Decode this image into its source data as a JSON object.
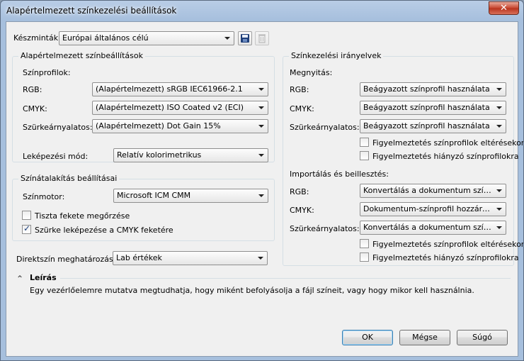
{
  "window": {
    "title": "Alapértelmezett színkezelési beállítások",
    "close_glyph": "✕"
  },
  "presets": {
    "label": "Készminták:",
    "value": "Európai általános célú"
  },
  "defaults_group": {
    "title": "Alapértelmezett színbeállítások",
    "profiles_heading": "Színprofilok:",
    "rgb_label": "RGB:",
    "rgb_value": "(Alapértelmezett) sRGB IEC61966-2.1",
    "cmyk_label": "CMYK:",
    "cmyk_value": "(Alapértelmezett) ISO Coated v2 (ECI)",
    "gray_label": "Szürkeárnyalatos:",
    "gray_value": "(Alapértelmezett) Dot Gain 15%",
    "mapping_label": "Leképezési mód:",
    "mapping_value": "Relatív kolorimetrikus"
  },
  "conversion_group": {
    "title": "Színátalakítás beállításai",
    "engine_label": "Színmotor:",
    "engine_value": "Microsoft ICM CMM",
    "preserve_black": "Tiszta fekete megőrzése",
    "preserve_black_checked": false,
    "gray_to_black": "Szürke leképezése a CMYK feketére",
    "gray_to_black_checked": true
  },
  "spot": {
    "label": "Direktszín meghatározása:",
    "value": "Lab értékek"
  },
  "policy_group": {
    "title": "Színkezelési irányelvek",
    "open_heading": "Megnyitás:",
    "open_rgb_label": "RGB:",
    "open_rgb_value": "Beágyazott színprofil használata",
    "open_cmyk_label": "CMYK:",
    "open_cmyk_value": "Beágyazott színprofil használata",
    "open_gray_label": "Szürkeárnyalatos:",
    "open_gray_value": "Beágyazott színprofil használata",
    "open_warn_mismatch": "Figyelmeztetés színprofilok eltérésekor",
    "open_warn_missing": "Figyelmeztetés hiányzó színprofilokra",
    "import_heading": "Importálás és beillesztés:",
    "import_rgb_label": "RGB:",
    "import_rgb_value": "Konvertálás a dokumentum színprofi...",
    "import_cmyk_label": "CMYK:",
    "import_cmyk_value": "Dokumentum-színprofil hozzárendel...",
    "import_gray_label": "Szürkeárnyalatos:",
    "import_gray_value": "Konvertálás a dokumentum színprofi...",
    "import_warn_mismatch": "Figyelmeztetés színprofilok eltérésekor",
    "import_warn_missing": "Figyelmeztetés hiányzó színprofilokra"
  },
  "description": {
    "title": "Leírás",
    "text": "Egy vezérlőelemre mutatva megtudhatja, hogy miként befolyásolja a fájl színeit, vagy hogy mikor kell használnia."
  },
  "buttons": {
    "ok": "OK",
    "cancel": "Mégse",
    "help": "Súgó"
  }
}
